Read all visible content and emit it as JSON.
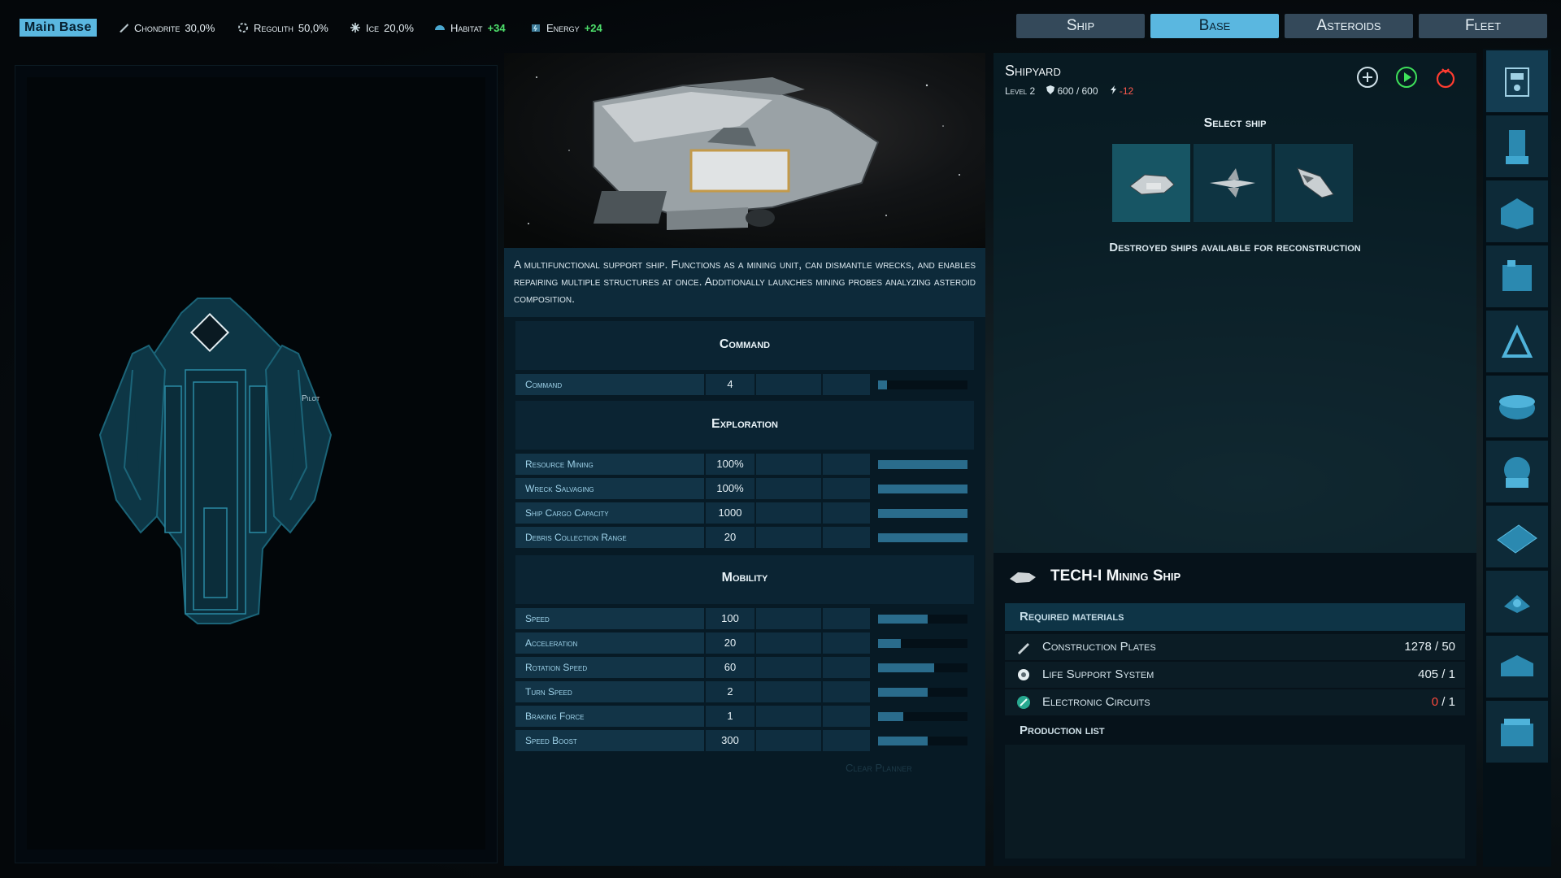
{
  "topbar": {
    "base_name": "Main Base",
    "resources": [
      {
        "name": "Chondrite",
        "value": "30,0%",
        "icon": "chondrite-icon"
      },
      {
        "name": "Regolith",
        "value": "50,0%",
        "icon": "regolith-icon"
      },
      {
        "name": "Ice",
        "value": "20,0%",
        "icon": "ice-icon"
      },
      {
        "name": "Habitat",
        "value": "+34",
        "icon": "habitat-icon"
      },
      {
        "name": "Energy",
        "value": "+24",
        "icon": "energy-icon"
      }
    ],
    "tabs": [
      "Ship",
      "Base",
      "Asteroids",
      "Fleet"
    ],
    "active_tab": "Base"
  },
  "schematic": {
    "slot_label": "Pilot"
  },
  "ship_info": {
    "description": "A multifunctional support ship. Functions as a mining unit, can dismantle wrecks, and enables repairing multiple structures at once. Additionally launches mining probes analyzing asteroid composition.",
    "sections": [
      {
        "title": "Command",
        "stats": [
          {
            "label": "Command",
            "value": "4",
            "level": 0.1
          }
        ]
      },
      {
        "title": "Exploration",
        "stats": [
          {
            "label": "Resource Mining",
            "value": "100%",
            "level": 1.0
          },
          {
            "label": "Wreck Salvaging",
            "value": "100%",
            "level": 1.0
          },
          {
            "label": "Ship Cargo Capacity",
            "value": "1000",
            "level": 1.0
          },
          {
            "label": "Debris Collection Range",
            "value": "20",
            "level": 1.0
          }
        ]
      },
      {
        "title": "Mobility",
        "stats": [
          {
            "label": "Speed",
            "value": "100",
            "level": 0.55
          },
          {
            "label": "Acceleration",
            "value": "20",
            "level": 0.25
          },
          {
            "label": "Rotation Speed",
            "value": "60",
            "level": 0.63
          },
          {
            "label": "Turn Speed",
            "value": "2",
            "level": 0.55
          },
          {
            "label": "Braking Force",
            "value": "1",
            "level": 0.28
          },
          {
            "label": "Speed Boost",
            "value": "300",
            "level": 0.55
          }
        ]
      }
    ],
    "clear_planner": "Clear Planner"
  },
  "shipyard": {
    "title": "Shipyard",
    "level": "Level 2",
    "hp": "600 / 600",
    "energy": "-12",
    "select_title": "Select ship",
    "destroyed_title": "Destroyed ships available for reconstruction",
    "recipe": {
      "name": "TECH-I Mining Ship",
      "required_title": "Required materials",
      "materials": [
        {
          "name": "Construction Plates",
          "have": "1278",
          "need": "50",
          "short": false,
          "icon": "construction-plates-icon"
        },
        {
          "name": "Life Support System",
          "have": "405",
          "need": "1",
          "short": false,
          "icon": "life-support-icon"
        },
        {
          "name": "Electronic Circuits",
          "have": "0",
          "need": "1",
          "short": true,
          "icon": "electronic-circuits-icon"
        }
      ],
      "production_title": "Production list"
    }
  },
  "colors": {
    "accent": "#5ab7e0",
    "positive": "#4ee06c",
    "negative": "#ff4a3d",
    "panel": "#071a25"
  }
}
